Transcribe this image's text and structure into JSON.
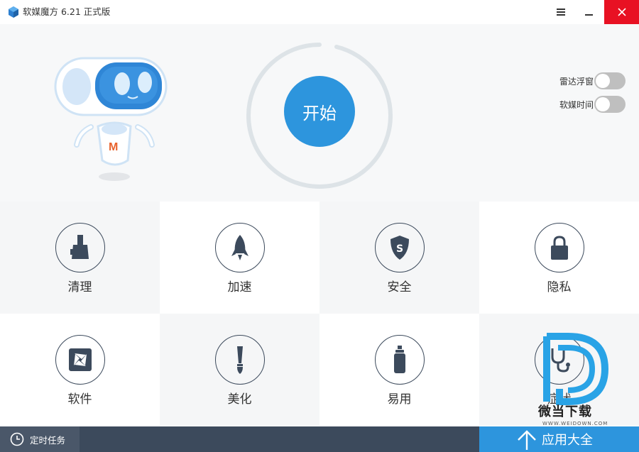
{
  "window": {
    "title": "软媒魔方 6.21 正式版",
    "controls": [
      "menu-icon",
      "minimize-icon",
      "close-icon"
    ],
    "close_color": "#e81123"
  },
  "hero": {
    "start_label": "开始",
    "accent": "#2d95dd",
    "toggles": [
      {
        "label": "雷达浮窗",
        "on": false
      },
      {
        "label": "软媒时间",
        "on": false
      }
    ],
    "mascot_badge": "M"
  },
  "tiles": [
    {
      "label": "清理",
      "icon": "broom-icon"
    },
    {
      "label": "加速",
      "icon": "rocket-icon"
    },
    {
      "label": "安全",
      "icon": "shield-icon"
    },
    {
      "label": "隐私",
      "icon": "lock-icon"
    },
    {
      "label": "软件",
      "icon": "aperture-icon"
    },
    {
      "label": "美化",
      "icon": "brush-icon"
    },
    {
      "label": "易用",
      "icon": "bottle-icon"
    },
    {
      "label": "症状",
      "icon": "stethoscope-icon"
    }
  ],
  "bottom": {
    "task_label": "定时任务",
    "apps_label": "应用大全"
  },
  "watermark": {
    "text": "微当下载",
    "sub": "WWW.WEIDOWN.COM"
  }
}
